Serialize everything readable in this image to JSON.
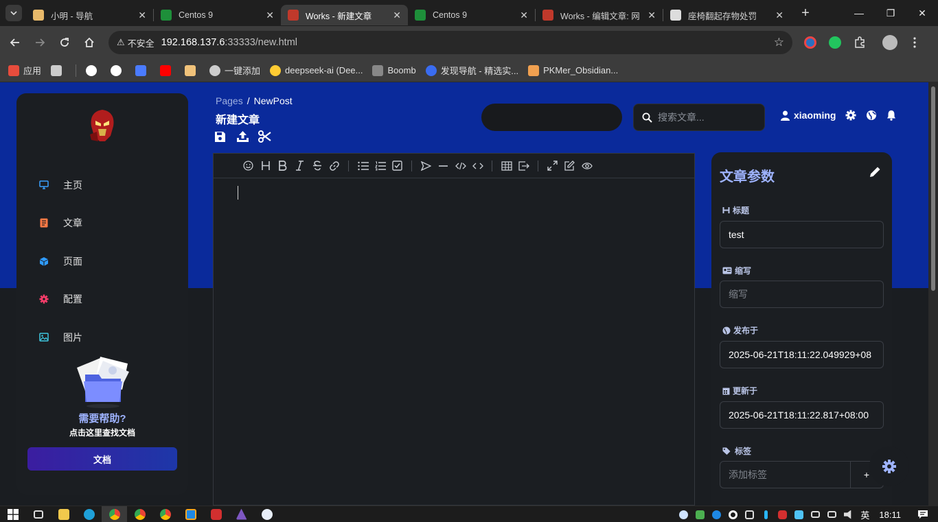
{
  "browser": {
    "tabs": [
      {
        "title": "小明 - 导航",
        "favicon_color": "#e8b96a",
        "active": false
      },
      {
        "title": "Centos 9",
        "favicon_color": "#1e8f3a",
        "active": false
      },
      {
        "title": "Works - 新建文章",
        "favicon_color": "#c0392b",
        "active": true
      },
      {
        "title": "Centos 9",
        "favicon_color": "#1e8f3a",
        "active": false
      },
      {
        "title": "Works - 编辑文章: 网",
        "favicon_color": "#c0392b",
        "active": false
      },
      {
        "title": "座椅翻起存物处罚",
        "favicon_color": "#dddddd",
        "active": false
      }
    ],
    "close_glyph": "✕",
    "newtab_glyph": "+",
    "window_controls": [
      "—",
      "❐",
      "✕"
    ],
    "address": {
      "insecure_label": "不安全",
      "host": "192.168.137.6",
      "path": ":33333/new.html"
    },
    "bookmarks": [
      {
        "label": "应用",
        "icon": "apps-icon",
        "color": "#e74c3c"
      },
      {
        "label": "",
        "icon": "grid-icon",
        "color": "#cccccc"
      },
      {
        "label": "",
        "icon": "openai-icon",
        "color": "#ffffff"
      },
      {
        "label": "",
        "icon": "github-icon",
        "color": "#ffffff"
      },
      {
        "label": "",
        "icon": "bird-icon",
        "color": "#4a7bff"
      },
      {
        "label": "",
        "icon": "youtube-icon",
        "color": "#ff0000"
      },
      {
        "label": "",
        "icon": "bookmark-img-icon",
        "color": "#f0c27a"
      },
      {
        "label": "一键添加",
        "icon": "globe-icon",
        "color": "#cccccc"
      },
      {
        "label": "deepseek-ai (Dee...",
        "icon": "hug-icon",
        "color": "#ffcc33"
      },
      {
        "label": "Boomb",
        "icon": "boomb-icon",
        "color": "#888888"
      },
      {
        "label": "发现导航 - 精选实...",
        "icon": "compass-icon",
        "color": "#3a6cf0"
      },
      {
        "label": "PKMer_Obsidian...",
        "icon": "pkmer-icon",
        "color": "#f0a050"
      }
    ]
  },
  "sidebar": {
    "nav": [
      {
        "label": "主页",
        "icon": "monitor-icon",
        "color": "#3aa0ff"
      },
      {
        "label": "文章",
        "icon": "article-icon",
        "color": "#ff7a45"
      },
      {
        "label": "页面",
        "icon": "cube-icon",
        "color": "#2f9bff"
      },
      {
        "label": "配置",
        "icon": "gear-icon",
        "color": "#ff3d6b"
      },
      {
        "label": "图片",
        "icon": "image-icon",
        "color": "#3ec7e0"
      }
    ],
    "help_title": "需要帮助?",
    "help_subtitle": "点击这里查找文档",
    "doc_button": "文档"
  },
  "header": {
    "breadcrumb_parent": "Pages",
    "breadcrumb_sep": "/",
    "breadcrumb_current": "NewPost",
    "title": "新建文章",
    "search_placeholder": "搜索文章...",
    "username": "xiaoming"
  },
  "params": {
    "heading": "文章参数",
    "title_label": "标题",
    "title_value": "test",
    "abbr_label": "缩写",
    "abbr_placeholder": "缩写",
    "published_label": "发布于",
    "published_value": "2025-06-21T18:11:22.049929+08",
    "updated_label": "更新于",
    "updated_value": "2025-06-21T18:11:22.817+08:00",
    "tags_label": "标签",
    "tags_placeholder": "添加标签",
    "tags_add": "+"
  },
  "taskbar": {
    "ime": "英",
    "time": "18:11"
  },
  "colors": {
    "accent_blue": "#0a2a9b",
    "panel": "#1b1e22",
    "label_blue": "#9eb3ff"
  }
}
